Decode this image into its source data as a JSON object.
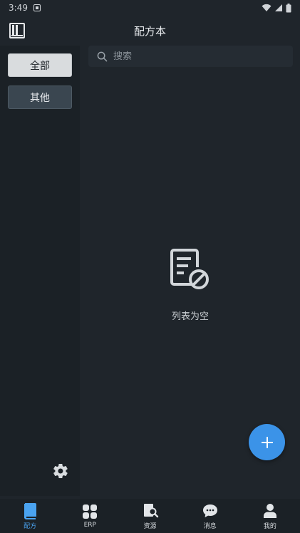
{
  "status": {
    "time": "3:49"
  },
  "header": {
    "title": "配方本"
  },
  "sidebar": {
    "categories": [
      {
        "label": "全部",
        "active": true
      },
      {
        "label": "其他",
        "active": false
      }
    ]
  },
  "search": {
    "placeholder": "搜索",
    "value": ""
  },
  "empty_state": {
    "text": "列表为空"
  },
  "bottom_nav": {
    "items": [
      {
        "label": "配方",
        "icon": "recipe-book-icon",
        "active": true
      },
      {
        "label": "ERP",
        "icon": "grid-icon",
        "active": false
      },
      {
        "label": "资源",
        "icon": "resource-search-icon",
        "active": false
      },
      {
        "label": "消息",
        "icon": "chat-bubble-icon",
        "active": false
      },
      {
        "label": "我的",
        "icon": "person-icon",
        "active": false
      }
    ]
  },
  "colors": {
    "accent": "#3b93e8",
    "background": "#1f252b",
    "active_nav": "#4aa3f0"
  }
}
